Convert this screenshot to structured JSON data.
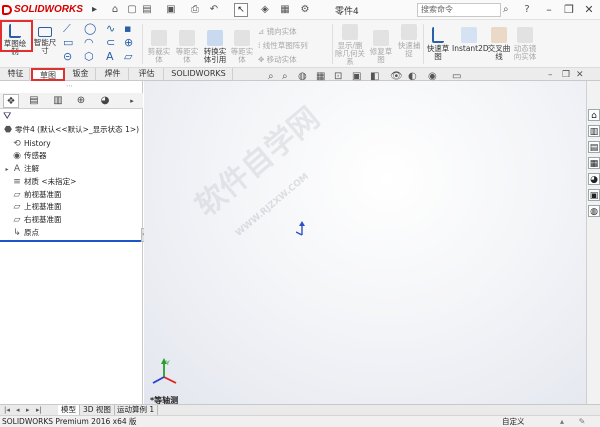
{
  "app": {
    "logo_text": "SOLIDWORKS",
    "doc_title": "零件4",
    "search_placeholder": "搜索命令"
  },
  "ribbon": {
    "sketch_btn": "草图绘制",
    "smart_dim_btn": "智能尺寸",
    "convert_entities": "转换实体引用",
    "trim_entities": "剪裁实体",
    "offset_entities": "等距实体",
    "mirror_entities": "镜向实体",
    "linear_pattern": "线性草图阵列",
    "move_entities": "移动实体",
    "show_relations": "显示/删除几何关系",
    "repair_sketch": "修复草图",
    "quick_snaps": "快速捕捉",
    "rapid_sketch": "快速草图",
    "instant2d": "Instant2D",
    "intersection_curve": "交叉曲线",
    "dynamic_mirror": "动态镜向实体"
  },
  "tabs": [
    "特征",
    "草图",
    "钣金",
    "焊件",
    "评估",
    "SOLIDWORKS MBD"
  ],
  "active_tab_index": 1,
  "tree": {
    "root": "零件4 (默认<<默认>_显示状态 1>)",
    "items": [
      {
        "icon": "history-icon",
        "glyph": "⟲",
        "label": "History"
      },
      {
        "icon": "sensor-icon",
        "glyph": "◉",
        "label": "传感器"
      },
      {
        "icon": "annotation-icon",
        "glyph": "A",
        "label": "注解"
      },
      {
        "icon": "material-icon",
        "glyph": "≡",
        "label": "材质 <未指定>"
      },
      {
        "icon": "plane-icon",
        "glyph": "▱",
        "label": "前视基准面"
      },
      {
        "icon": "plane-icon",
        "glyph": "▱",
        "label": "上视基准面"
      },
      {
        "icon": "plane-icon",
        "glyph": "▱",
        "label": "右视基准面"
      },
      {
        "icon": "origin-icon",
        "glyph": "↳",
        "label": "原点"
      }
    ]
  },
  "viewport": {
    "view_label": "*等轴测",
    "watermark_text": "软件自学网",
    "watermark_url": "WWW.RJZXW.COM"
  },
  "bottom_tabs": [
    "模型",
    "3D 视图",
    "运动算例 1"
  ],
  "active_bottom_tab": 0,
  "status": {
    "product": "SOLIDWORKS Premium 2016 x64 版",
    "custom": "自定义"
  },
  "colors": {
    "accent_red": "#d40000",
    "highlight_box": "#e03030",
    "rollback_bar": "#1e55c8"
  }
}
